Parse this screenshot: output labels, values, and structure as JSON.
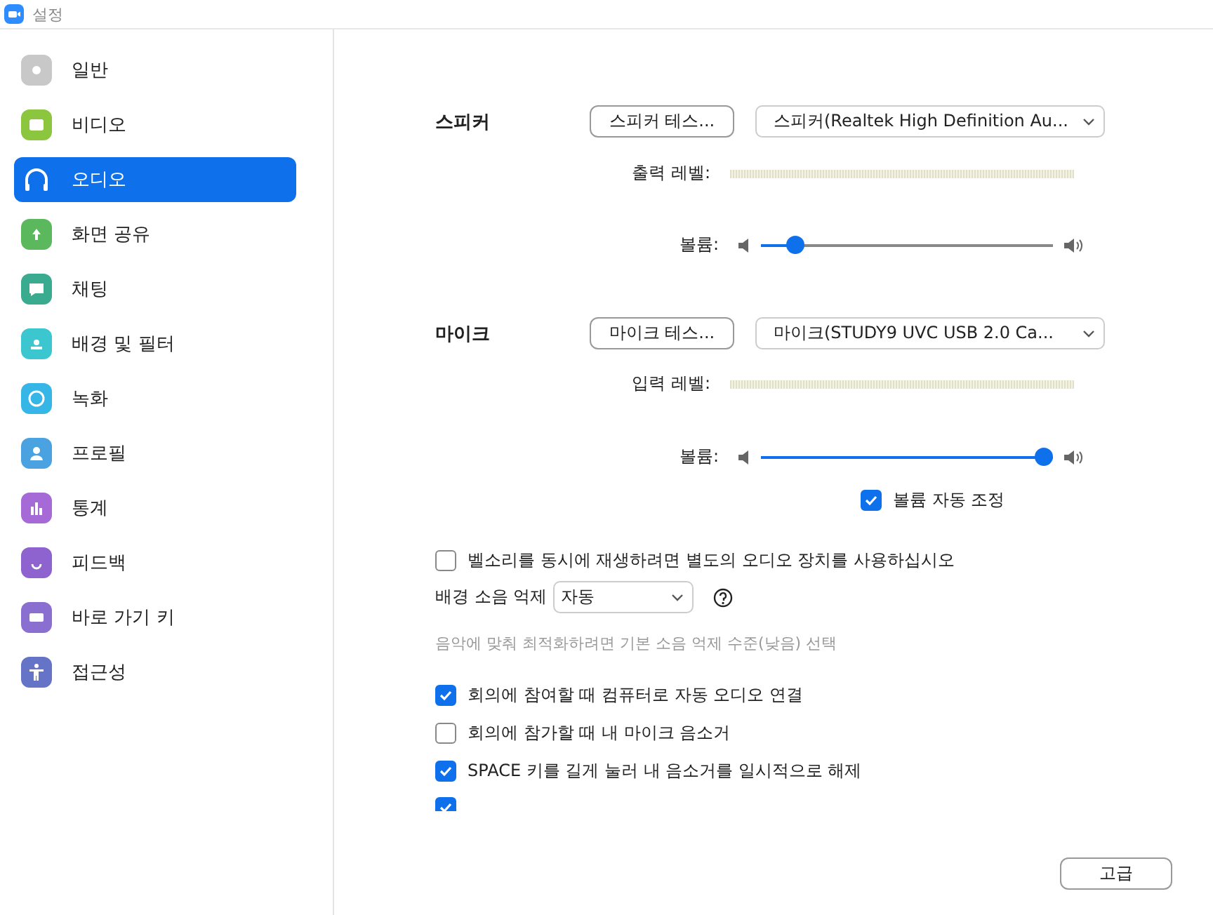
{
  "window": {
    "title": "설정"
  },
  "sidebar": {
    "items": [
      {
        "label": "일반",
        "selected": false
      },
      {
        "label": "비디오",
        "selected": false
      },
      {
        "label": "오디오",
        "selected": true
      },
      {
        "label": "화면 공유",
        "selected": false
      },
      {
        "label": "채팅",
        "selected": false
      },
      {
        "label": "배경 및 필터",
        "selected": false
      },
      {
        "label": "녹화",
        "selected": false
      },
      {
        "label": "프로필",
        "selected": false
      },
      {
        "label": "통계",
        "selected": false
      },
      {
        "label": "피드백",
        "selected": false
      },
      {
        "label": "바로 가기 키",
        "selected": false
      },
      {
        "label": "접근성",
        "selected": false
      }
    ]
  },
  "devices": [
    {
      "title": "스피커",
      "test_button": "스피커 테스...",
      "device": "스피커(Realtek High Definition Au...",
      "level_label": "출력 레벨:",
      "level": 0,
      "volume_label": "볼륨:",
      "volume": {
        "level": 0.12
      }
    },
    {
      "title": "마이크",
      "test_button": "마이크 테스...",
      "device": "마이크(STUDY9 UVC USB 2.0 Ca...",
      "level_label": "입력 레벨:",
      "level": 0,
      "volume_label": "볼륨:",
      "volume": {
        "level": 0.97
      },
      "auto_adjust": {
        "label": "볼륨 자동 조정",
        "checked": true
      }
    }
  ],
  "separate_ringtone": {
    "label": "벨소리를 동시에 재생하려면 별도의 오디오 장치를 사용하십시오",
    "checked": false
  },
  "noise_suppression": {
    "label": "배경 소음 억제",
    "value": "자동",
    "hint": "음악에 맞춰 최적화하려면 기본 소음 억제 수준(낮음) 선택"
  },
  "options": [
    {
      "label": "회의에 참여할 때 컴퓨터로 자동 오디오 연결",
      "checked": true
    },
    {
      "label": "회의에 참가할 때 내 마이크 음소거",
      "checked": false
    },
    {
      "label": "SPACE 키를 길게 눌러 내 음소거를 일시적으로 해제",
      "checked": true
    },
    {
      "checked": true
    }
  ],
  "advanced_button": "고급"
}
